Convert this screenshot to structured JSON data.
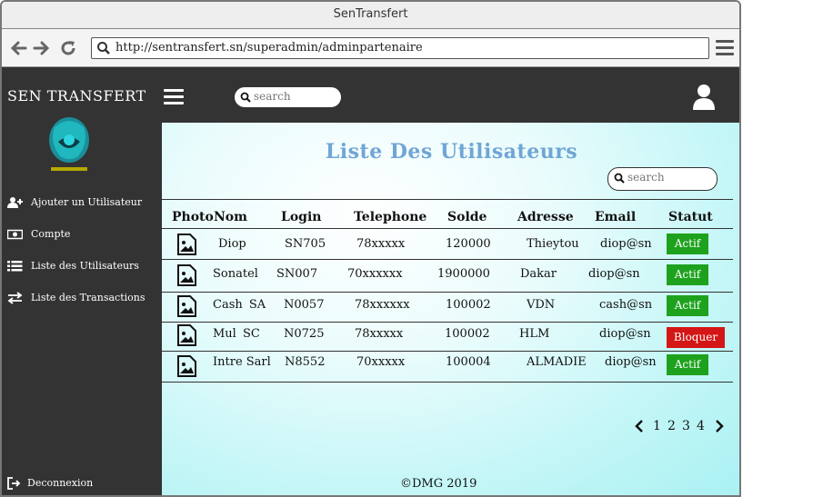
{
  "window": {
    "title": "SenTransfert"
  },
  "browser": {
    "url": "http://sentransfert.sn/superadmin/adminpartenaire"
  },
  "sidebar": {
    "brand": "SEN TRANSFERT",
    "items": [
      {
        "label": "Ajouter un Utilisateur",
        "icon": "add-user-icon"
      },
      {
        "label": "Compte",
        "icon": "money-icon"
      },
      {
        "label": "Liste des Utilisateurs",
        "icon": "list-icon"
      },
      {
        "label": "Liste des Transactions",
        "icon": "transfer-icon"
      }
    ],
    "logout": {
      "label": "Deconnexion",
      "icon": "sign-out-icon"
    }
  },
  "topbar": {
    "search_placeholder": "search"
  },
  "main": {
    "title": "Liste Des Utilisateurs",
    "search_placeholder": "search",
    "columns": [
      "Photo",
      "Nom",
      "Login",
      "Telephone",
      "Solde",
      "Adresse",
      "Email",
      "Statut"
    ],
    "rows": [
      {
        "nom": "Diop",
        "login": "SN705",
        "telephone": "78xxxxx",
        "solde": "120000",
        "adresse": "Thieytou",
        "email": "diop@sn",
        "statut": "Actif"
      },
      {
        "nom": "Sonatel",
        "login": "SN007",
        "telephone": "70xxxxxx",
        "solde": "1900000",
        "adresse": "Dakar",
        "email": "diop@sn",
        "statut": "Actif"
      },
      {
        "nom": "Cash SA",
        "login": "N0057",
        "telephone": "78xxxxxx",
        "solde": "100002",
        "adresse": "VDN",
        "email": "cash@sn",
        "statut": "Actif"
      },
      {
        "nom": "Mul SC",
        "login": "N0725",
        "telephone": "78xxxxx",
        "solde": "100002",
        "adresse": "HLM",
        "email": "diop@sn",
        "statut": "Bloquer"
      },
      {
        "nom": "Intre Sarl",
        "login": "N8552",
        "telephone": "70xxxxx",
        "solde": "100004",
        "adresse": "ALMADIE",
        "email": "diop@sn",
        "statut": "Actif"
      }
    ],
    "pagination": [
      "1",
      "2",
      "3",
      "4"
    ],
    "footer": "©DMG 2019"
  },
  "colors": {
    "sidebar": "#333333",
    "title": "#6fa6d6",
    "actif": "#1ea21e",
    "bloquer": "#d41616"
  }
}
